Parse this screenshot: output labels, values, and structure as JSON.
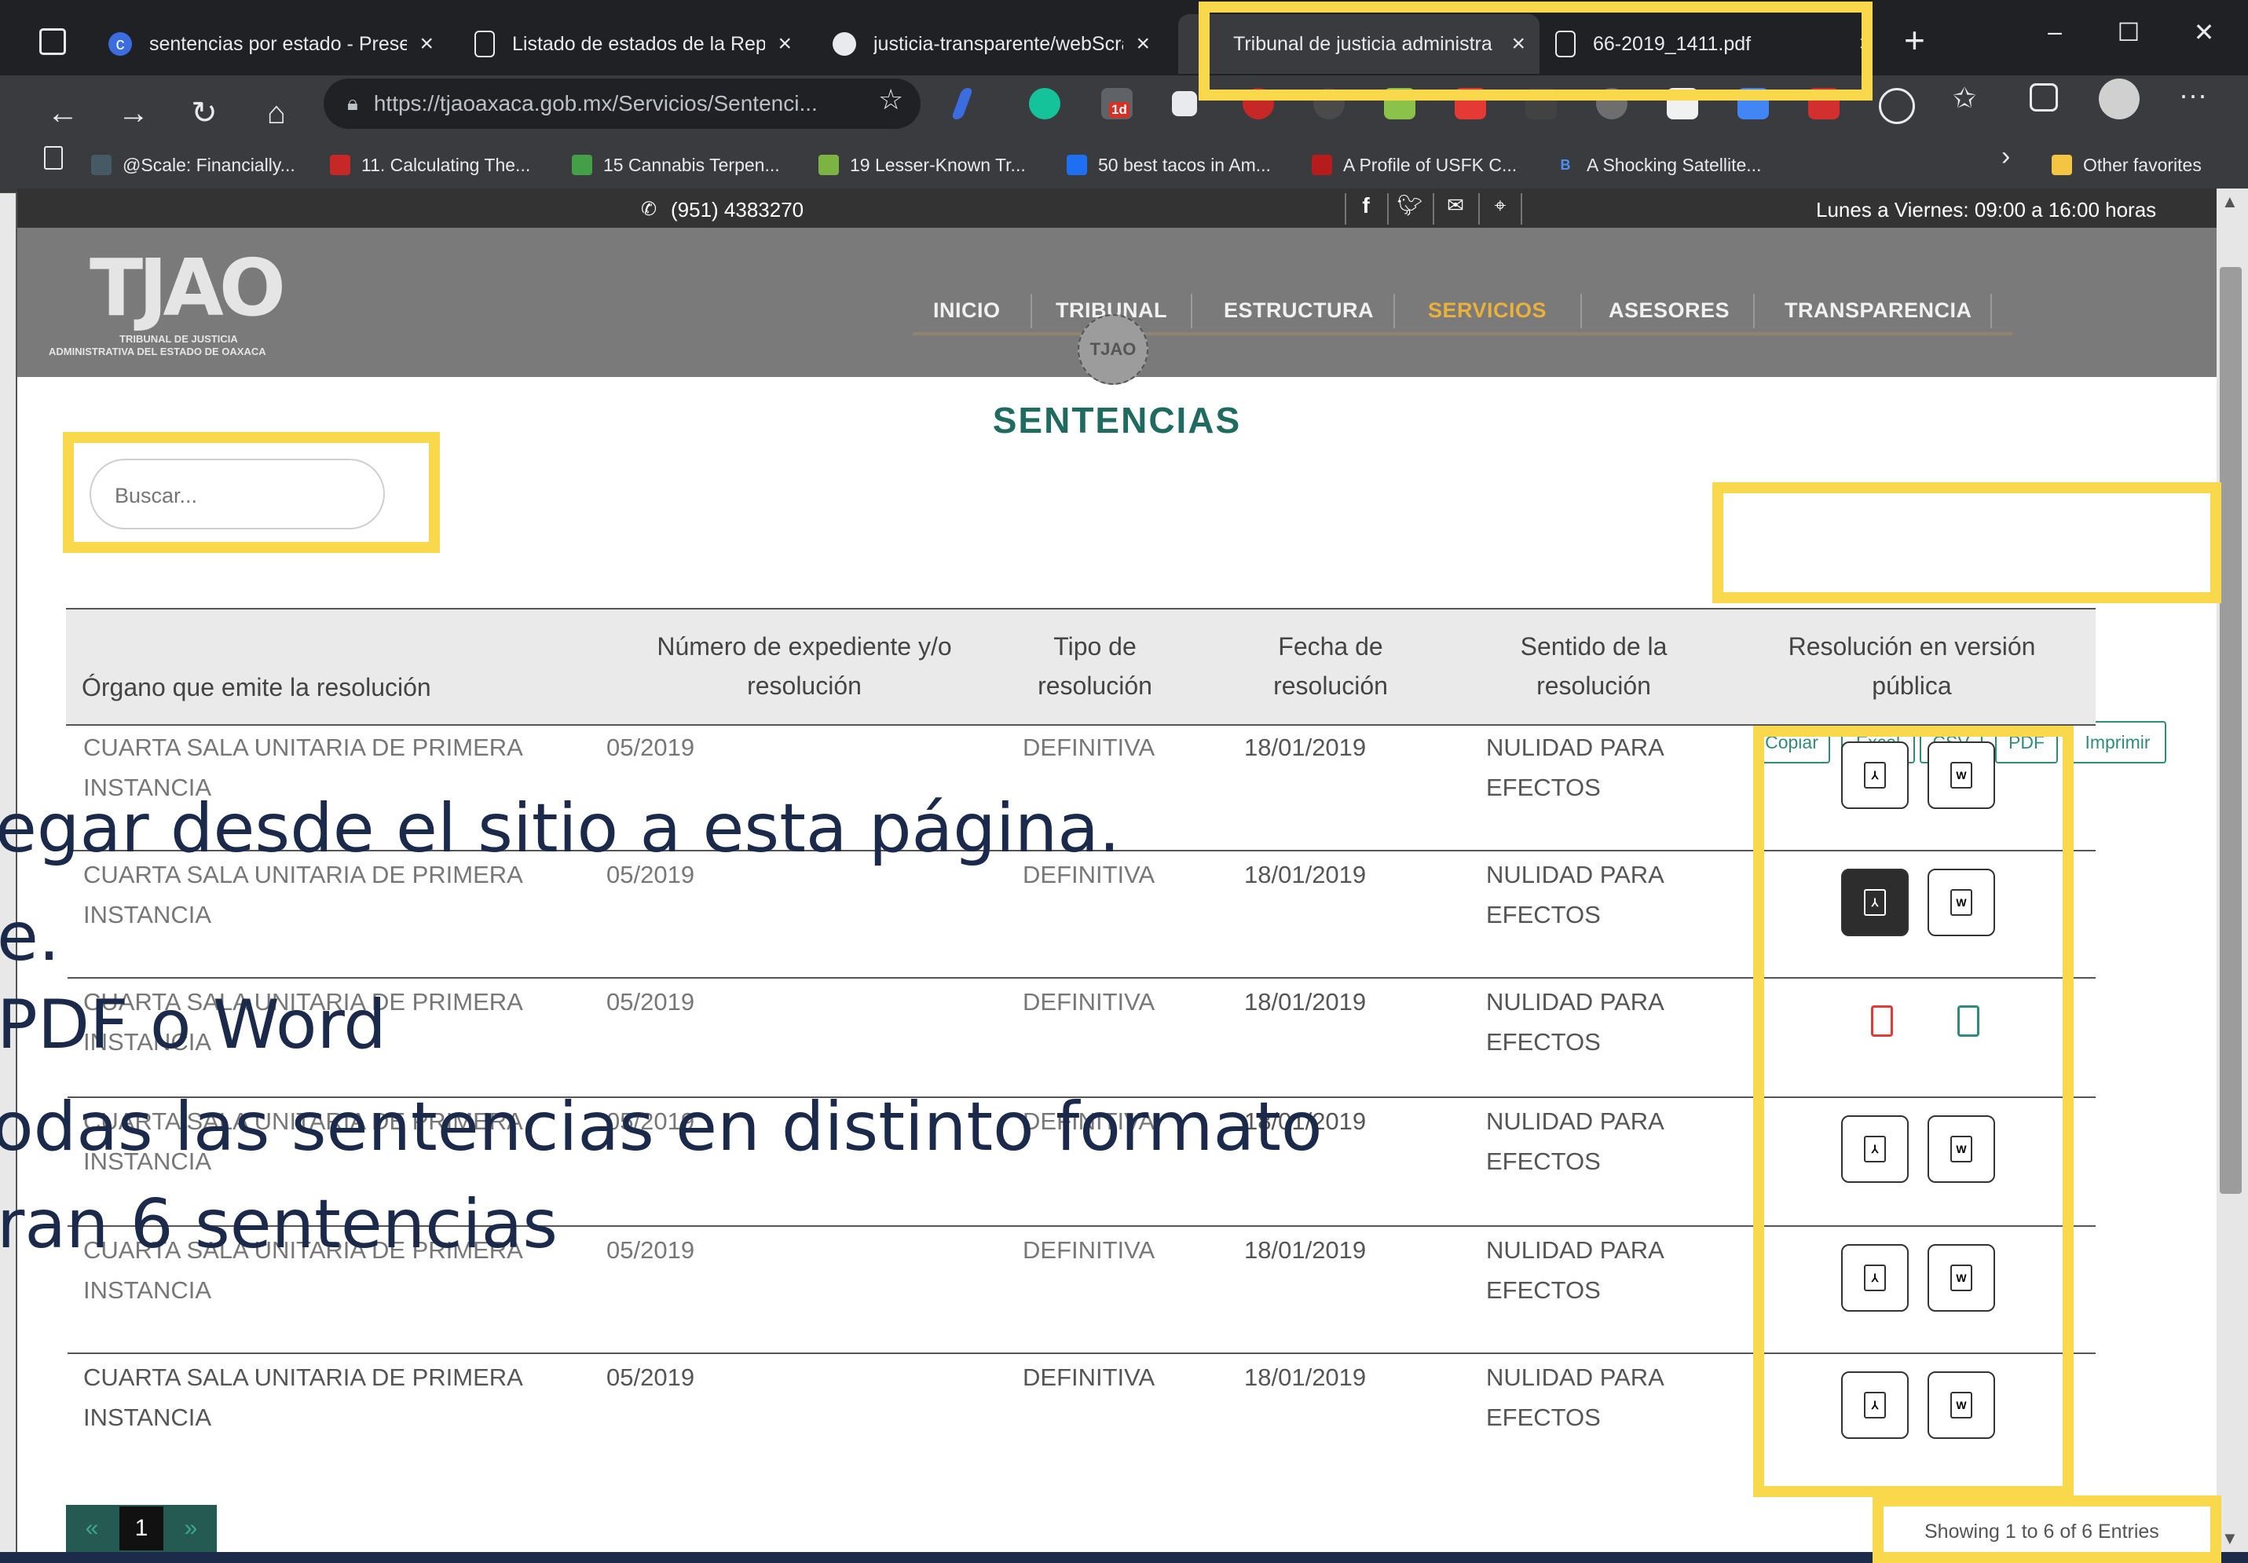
{
  "browser": {
    "tabs": [
      {
        "label": "sentencias por estado - Prese",
        "icon": "c-icon"
      },
      {
        "label": "Listado de estados de la Repú",
        "icon": "page-icon"
      },
      {
        "label": "justicia-transparente/webScra",
        "icon": "github-icon"
      },
      {
        "label": "Tribunal de justicia administra",
        "icon": "tjao-icon",
        "active": true
      },
      {
        "label": "66-2019_1411.pdf",
        "icon": "page-icon"
      }
    ],
    "address": "https://tjaoaxaca.gob.mx/Servicios/Sentenci...",
    "address_host": "tjaoaxaca.gob.mx",
    "bookmarks": [
      "@Scale: Financially...",
      "11. Calculating The...",
      "15 Cannabis Terpen...",
      "19 Lesser-Known Tr...",
      "50 best tacos in Am...",
      "A Profile of USFK C...",
      "A Shocking Satellite..."
    ],
    "other_favorites": "Other favorites",
    "ext_badge": "1d"
  },
  "site": {
    "phone": "(951) 4383270",
    "hours": "Lunes a Viernes: 09:00 a 16:00 horas",
    "logo_letters": "TJAO",
    "logo_line1": "TRIBUNAL DE JUSTICIA",
    "logo_line2": "ADMINISTRATIVA DEL ESTADO DE OAXACA",
    "menu": [
      "INICIO",
      "TRIBUNAL",
      "ESTRUCTURA",
      "SERVICIOS",
      "ASESORES",
      "TRANSPARENCIA"
    ],
    "menu_active": "SERVICIOS",
    "seal_text": "TJAO"
  },
  "main": {
    "title": "SENTENCIAS",
    "search_placeholder": "Buscar...",
    "export_buttons": [
      "Copiar",
      "Excel",
      "CSV",
      "PDF",
      "Imprimir"
    ],
    "columns": [
      "Órgano que emite la resolución",
      "Número de expediente y/o resolución",
      "Tipo de resolución",
      "Fecha de resolución",
      "Sentido de la resolución",
      "Resolución en versión pública"
    ],
    "rows": [
      {
        "organo": "CUARTA SALA UNITARIA DE PRIMERA INSTANCIA",
        "numero": "05/2019",
        "tipo": "DEFINITIVA",
        "fecha": "18/01/2019",
        "sentido": "NULIDAD PARA EFECTOS"
      },
      {
        "organo": "CUARTA SALA UNITARIA DE PRIMERA INSTANCIA",
        "numero": "05/2019",
        "tipo": "DEFINITIVA",
        "fecha": "18/01/2019",
        "sentido": "NULIDAD PARA EFECTOS"
      },
      {
        "organo": "CUARTA SALA UNITARIA DE PRIMERA INSTANCIA",
        "numero": "05/2019",
        "tipo": "DEFINITIVA",
        "fecha": "18/01/2019",
        "sentido": "NULIDAD PARA EFECTOS"
      },
      {
        "organo": "CUARTA SALA UNITARIA DE PRIMERA INSTANCIA",
        "numero": "05/2019",
        "tipo": "DEFINITIVA",
        "fecha": "18/01/2019",
        "sentido": "NULIDAD PARA EFECTOS"
      },
      {
        "organo": "CUARTA SALA UNITARIA DE PRIMERA INSTANCIA",
        "numero": "05/2019",
        "tipo": "DEFINITIVA",
        "fecha": "18/01/2019",
        "sentido": "NULIDAD PARA EFECTOS"
      },
      {
        "organo": "CUARTA SALA UNITARIA DE PRIMERA INSTANCIA",
        "numero": "05/2019",
        "tipo": "DEFINITIVA",
        "fecha": "18/01/2019",
        "sentido": "NULIDAD PARA EFECTOS"
      }
    ],
    "pagination": {
      "prev": "«",
      "current": "1",
      "next": "»"
    },
    "entries_info": "Showing 1 to 6 of 6 Entries"
  },
  "overlay_text": [
    "egar desde el sitio a esta página.",
    "e.",
    "PDF o Word",
    "odas las sentencias en distinto formato",
    "ran 6 sentencias"
  ],
  "colors": {
    "highlight": "#f9d94b",
    "accent_teal": "#2e8c78",
    "title_teal": "#1f6b5f",
    "menu_active": "#e9b13a",
    "pdf_red": "#e53935"
  }
}
